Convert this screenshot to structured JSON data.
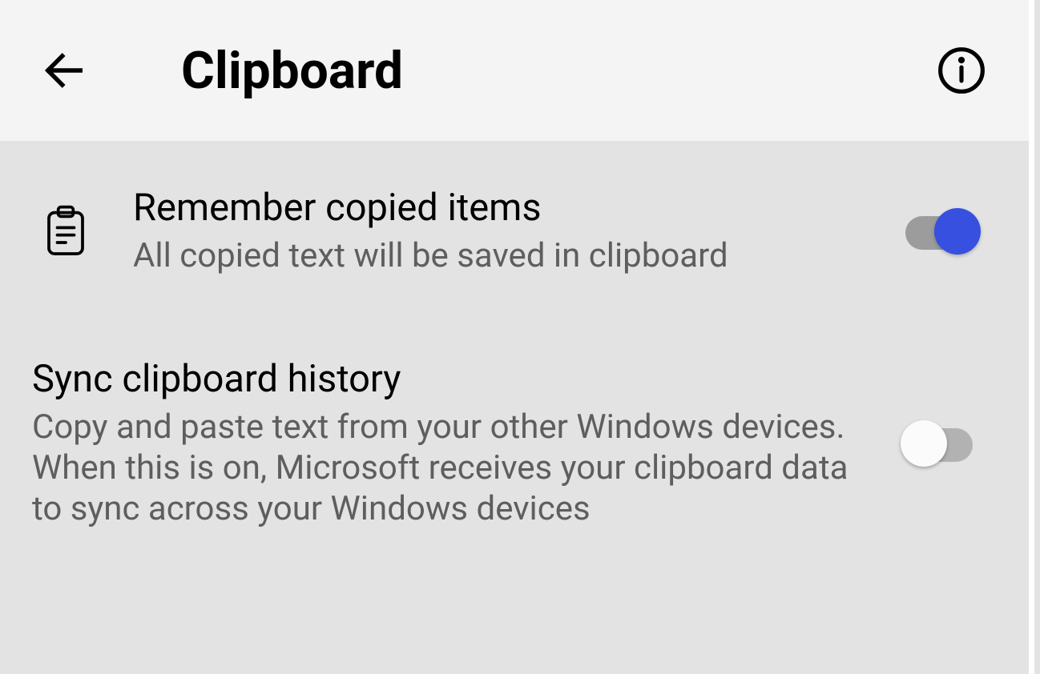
{
  "header": {
    "title": "Clipboard"
  },
  "settings": {
    "remember": {
      "title": "Remember copied items",
      "description": "All copied text will be saved in clipboard",
      "enabled": true
    },
    "sync": {
      "title": "Sync clipboard history",
      "description": "Copy and paste text from your other Windows devices. When this is on, Microsoft receives your clipboard data to sync across your Windows devices",
      "enabled": false
    }
  }
}
